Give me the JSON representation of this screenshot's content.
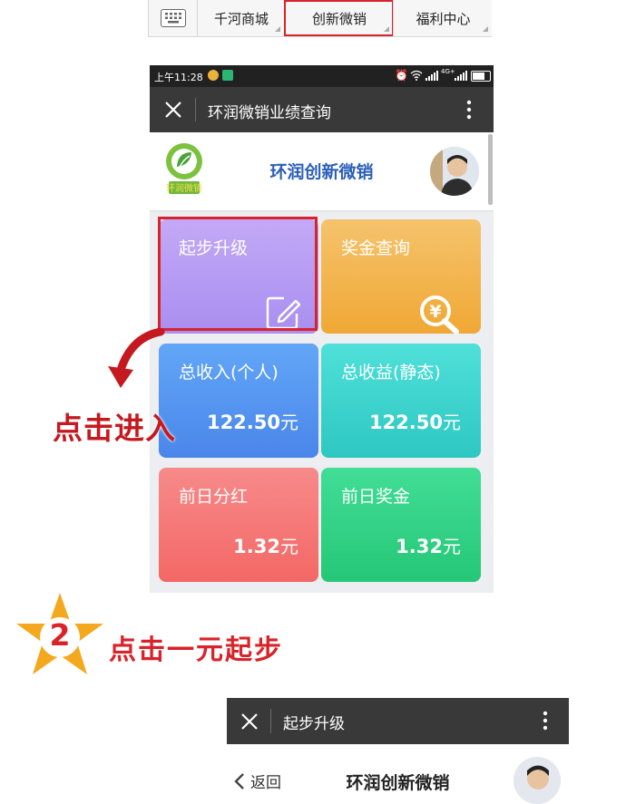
{
  "menubar": {
    "items": [
      "千河商城",
      "创新微销",
      "福利中心"
    ]
  },
  "phone1": {
    "status": {
      "time": "上午11:28",
      "network": "4G+"
    },
    "titlebar": {
      "title": "环润微销业绩查询"
    },
    "header": {
      "title": "环润创新微销",
      "logo_text": "环润微销"
    },
    "tiles": [
      {
        "label": "起步升级",
        "value": "",
        "unit": "",
        "color_from": "#c3a9f6",
        "color_to": "#a98ef0"
      },
      {
        "label": "奖金查询",
        "value": "",
        "unit": "",
        "color_from": "#f5c36c",
        "color_to": "#f0a835"
      },
      {
        "label": "总收入(个人)",
        "value": "122.50",
        "unit": "元",
        "color_from": "#62a6f7",
        "color_to": "#4a86ea"
      },
      {
        "label": "总收益(静态)",
        "value": "122.50",
        "unit": "元",
        "color_from": "#4fe0d9",
        "color_to": "#2ec7c2"
      },
      {
        "label": "前日分红",
        "value": "1.32",
        "unit": "元",
        "color_from": "#f78a8a",
        "color_to": "#f36866"
      },
      {
        "label": "前日奖金",
        "value": "1.32",
        "unit": "元",
        "color_from": "#41dd96",
        "color_to": "#26c777"
      }
    ]
  },
  "annotation": {
    "click_enter": "点击进入",
    "step_number": "2",
    "step_text": "点击一元起步",
    "accent": "#d8232a",
    "star_color": "#f4a81d"
  },
  "phone2": {
    "titlebar": {
      "title": "起步升级"
    },
    "header": {
      "back_label": "返回",
      "title": "环润创新微销"
    }
  }
}
